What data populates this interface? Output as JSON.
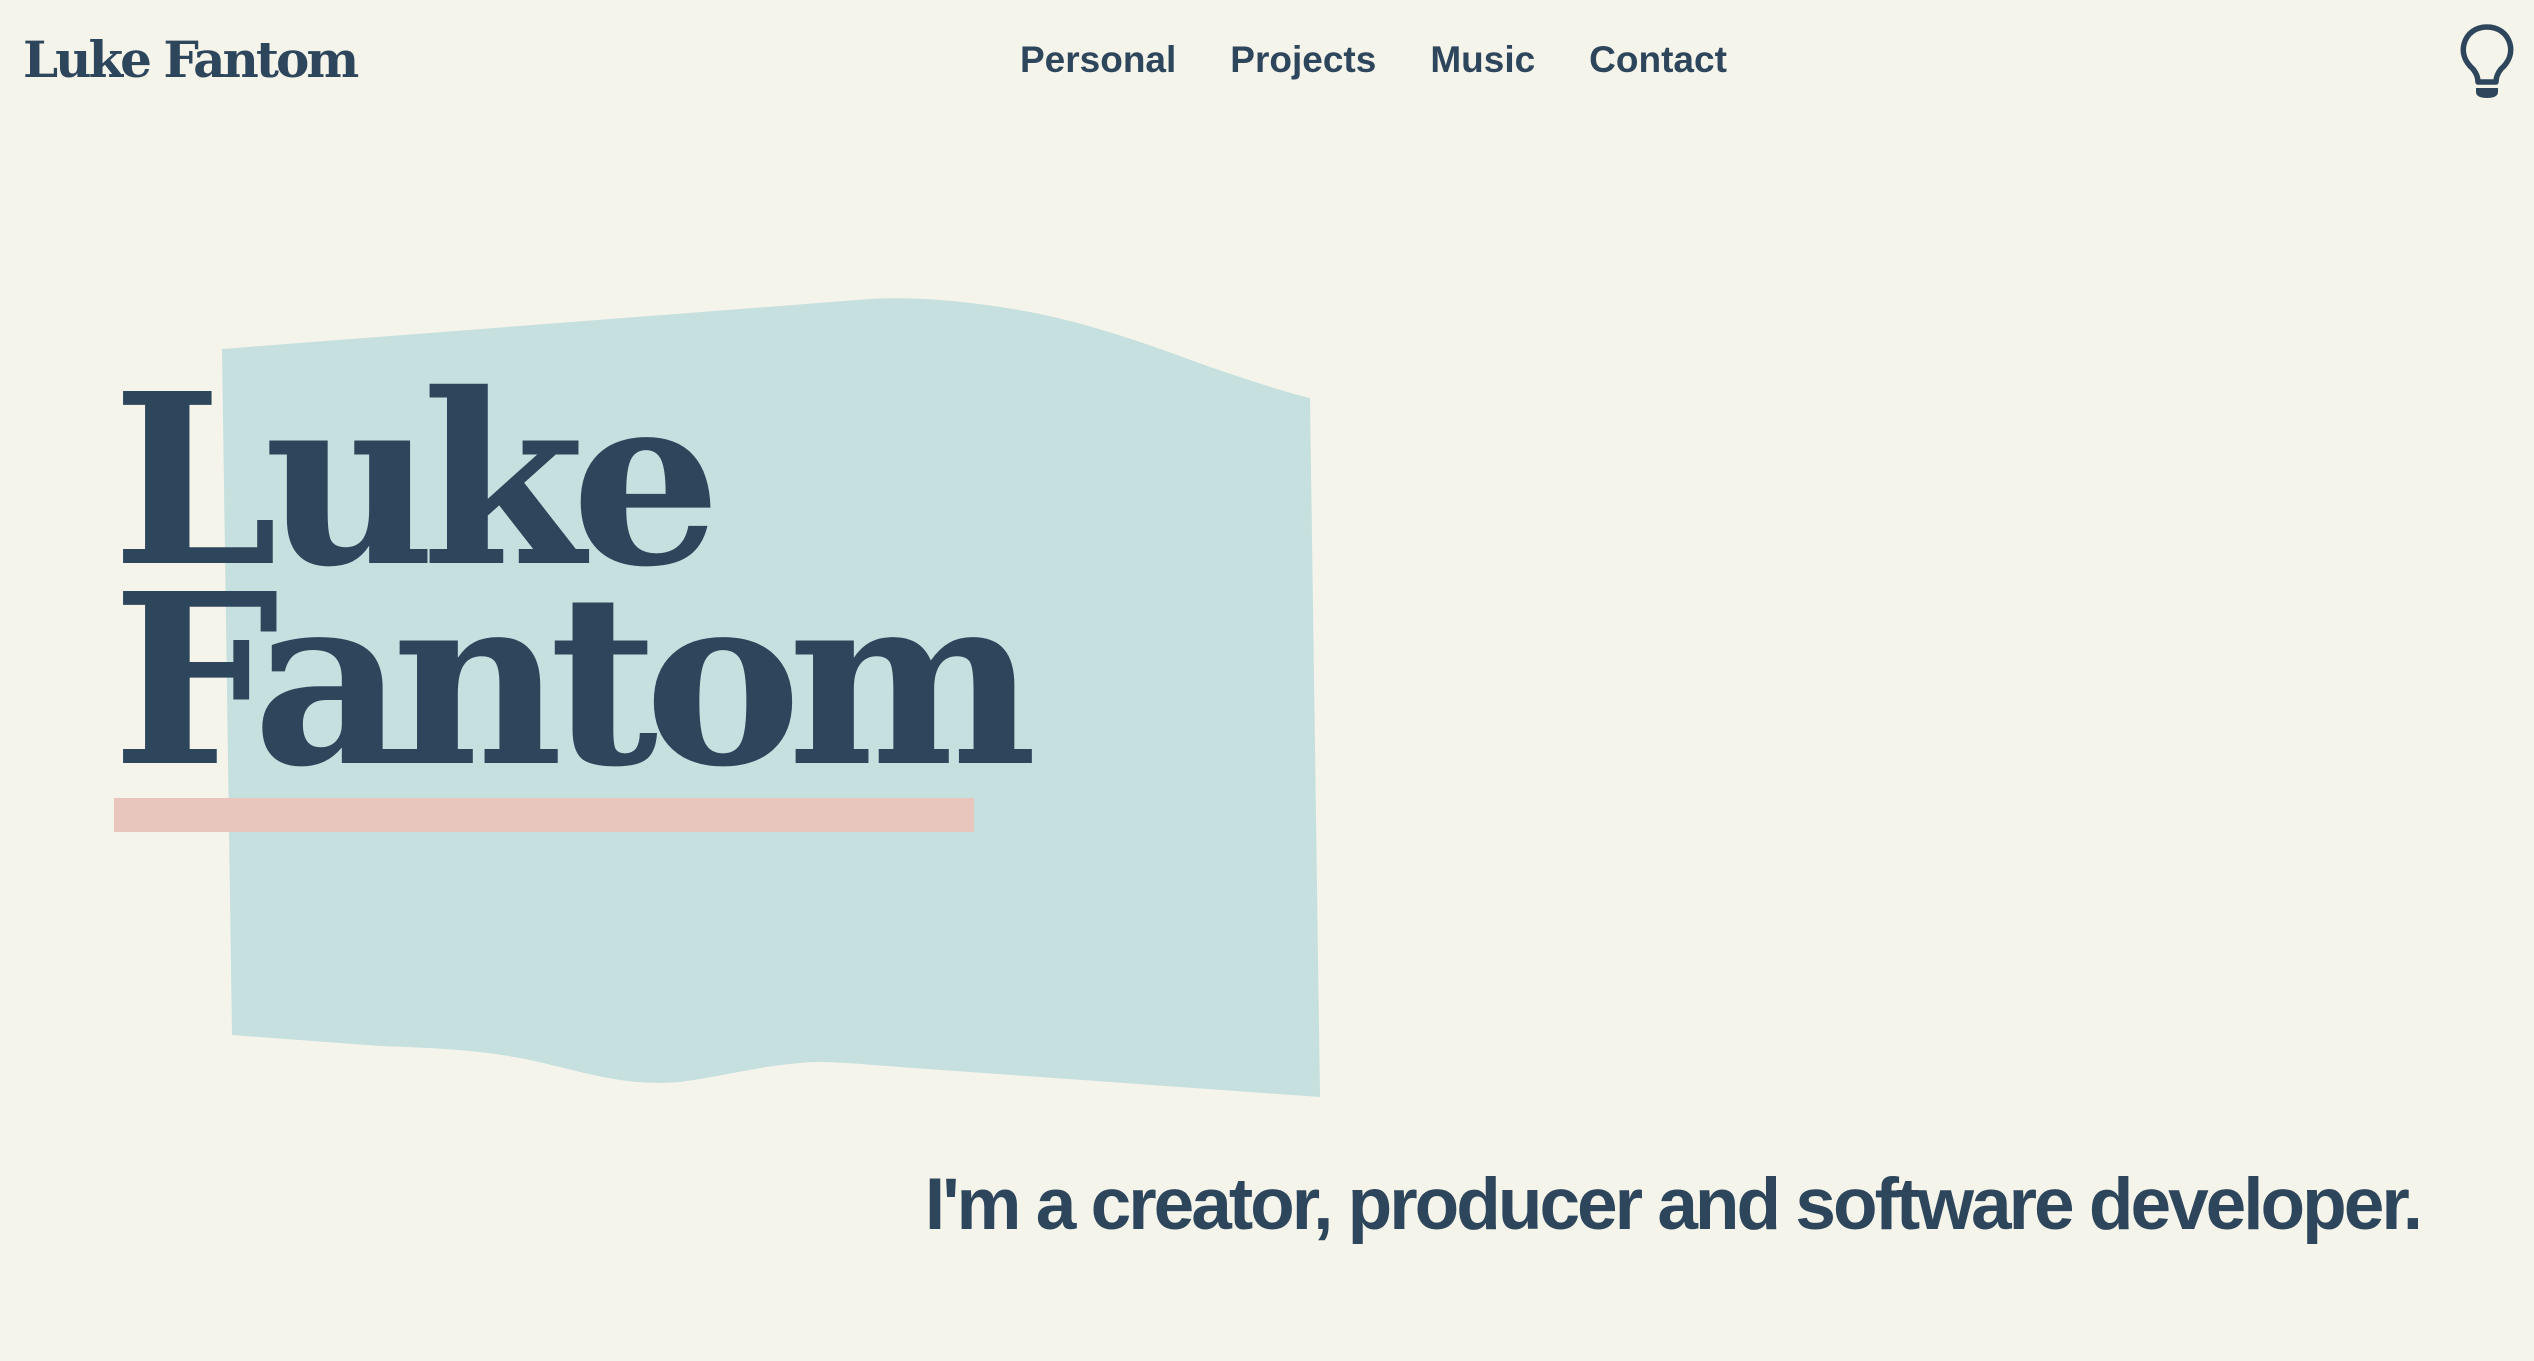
{
  "site": {
    "logo_text": "Luke Fantom"
  },
  "nav": {
    "items": [
      {
        "label": "Personal"
      },
      {
        "label": "Projects"
      },
      {
        "label": "Music"
      },
      {
        "label": "Contact"
      }
    ]
  },
  "theme_toggle": {
    "icon": "lightbulb-icon"
  },
  "hero": {
    "title_line_1": "Luke",
    "title_line_2": "Fantom",
    "tagline": "I'm a creator, producer and software developer."
  },
  "colors": {
    "background": "#f5f4ea",
    "text": "#2e465c",
    "blob": "#c5e0df",
    "underline": "#e8c5bd"
  }
}
